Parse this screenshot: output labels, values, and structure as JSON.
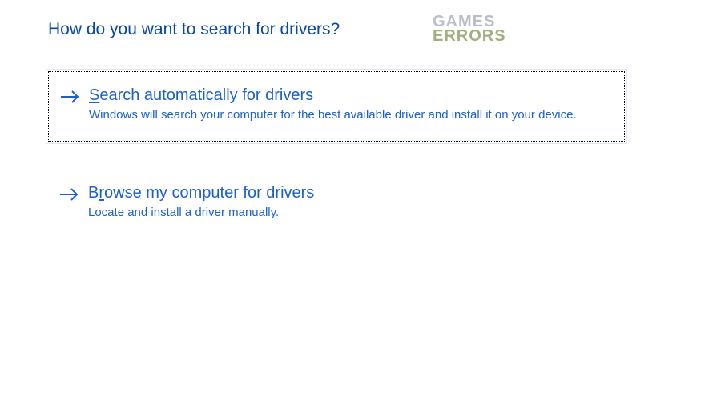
{
  "heading": "How do you want to search for drivers?",
  "watermark": {
    "line1": "GAMES",
    "line2": "ERRORS"
  },
  "options": [
    {
      "title_pre": "",
      "title_mnemonic": "S",
      "title_post": "earch automatically for drivers",
      "description": "Windows will search your computer for the best available driver and install it on your device.",
      "selected": true
    },
    {
      "title_pre": "B",
      "title_mnemonic": "r",
      "title_post": "owse my computer for drivers",
      "description": "Locate and install a driver manually.",
      "selected": false
    }
  ]
}
